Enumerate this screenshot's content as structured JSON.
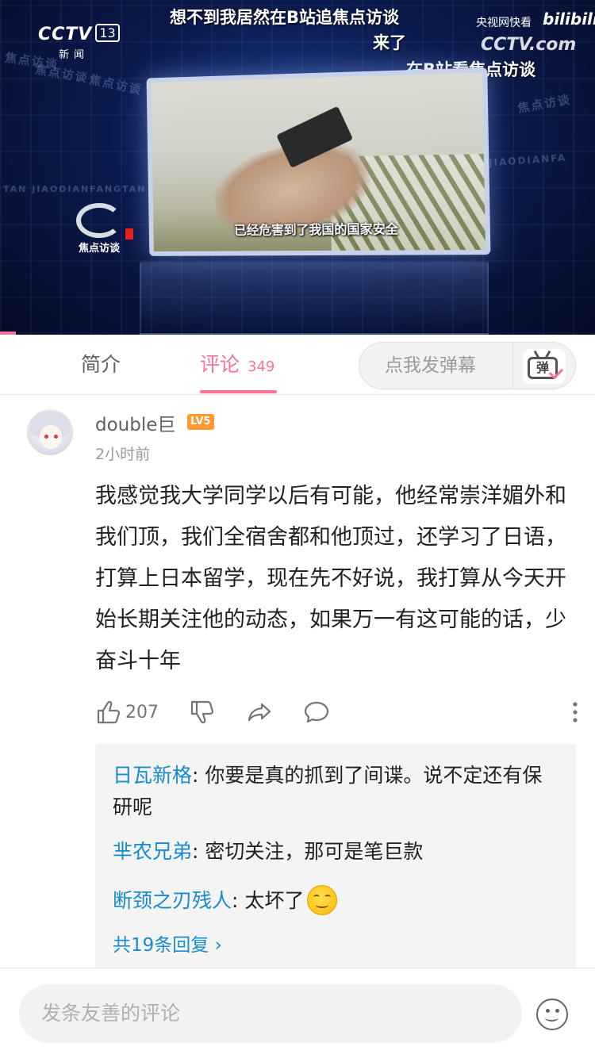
{
  "video": {
    "channel_logo": "CCTV",
    "channel_number": "13",
    "channel_sub": "新闻",
    "top_caption": "想不到我居然在B站追焦点访谈",
    "top_caption_2": "来了",
    "right_caption": "在B站看焦点访谈",
    "watermark_line1": "央视网快看",
    "watermark_bili": "bilibili",
    "watermark_cctv": "CCTV.com",
    "screen_subtitle": "已经危害到了我国的国家安全",
    "show_name": "焦点访谈",
    "background_text": "焦点访谈",
    "background_text_latin": "JIAODIANFA",
    "background_text_latin2": "TAN JIAODIANFANGTAN"
  },
  "tabs": {
    "intro_label": "简介",
    "comments_label": "评论",
    "comments_count": "349",
    "danmaku_placeholder": "点我发弹幕",
    "danmaku_icon_char": "弹"
  },
  "comment": {
    "username": "double巨",
    "level": "LV5",
    "time": "2小时前",
    "text": "我感觉我大学同学以后有可能，他经常崇洋媚外和我们顶，我们全宿舍都和他顶过，还学习了日语，打算上日本留学，现在先不好说，我打算从今天开始长期关注他的动态，如果万一有这可能的话，少奋斗十年",
    "likes": "207",
    "replies": [
      {
        "user": "日瓦新格",
        "sep": ": ",
        "text": "你要是真的抓到了间谍。说不定还有保研呢"
      },
      {
        "user": "芈农兄弟",
        "sep": ": ",
        "text": "密切关注，那可是笔巨款"
      },
      {
        "user": "断颈之刃残人",
        "sep": ": ",
        "text": "太坏了"
      }
    ],
    "more_replies": "共19条回复 ›"
  },
  "bottom": {
    "input_placeholder": "发条友善的评论"
  },
  "colors": {
    "accent": "#fb7299",
    "link": "#178bcf",
    "level_badge": "#ff9a2e"
  },
  "icons": [
    "thumbs-up-icon",
    "thumbs-down-icon",
    "share-icon",
    "reply-icon",
    "more-vertical-icon",
    "danmaku-tv-icon",
    "emoji-icon"
  ]
}
